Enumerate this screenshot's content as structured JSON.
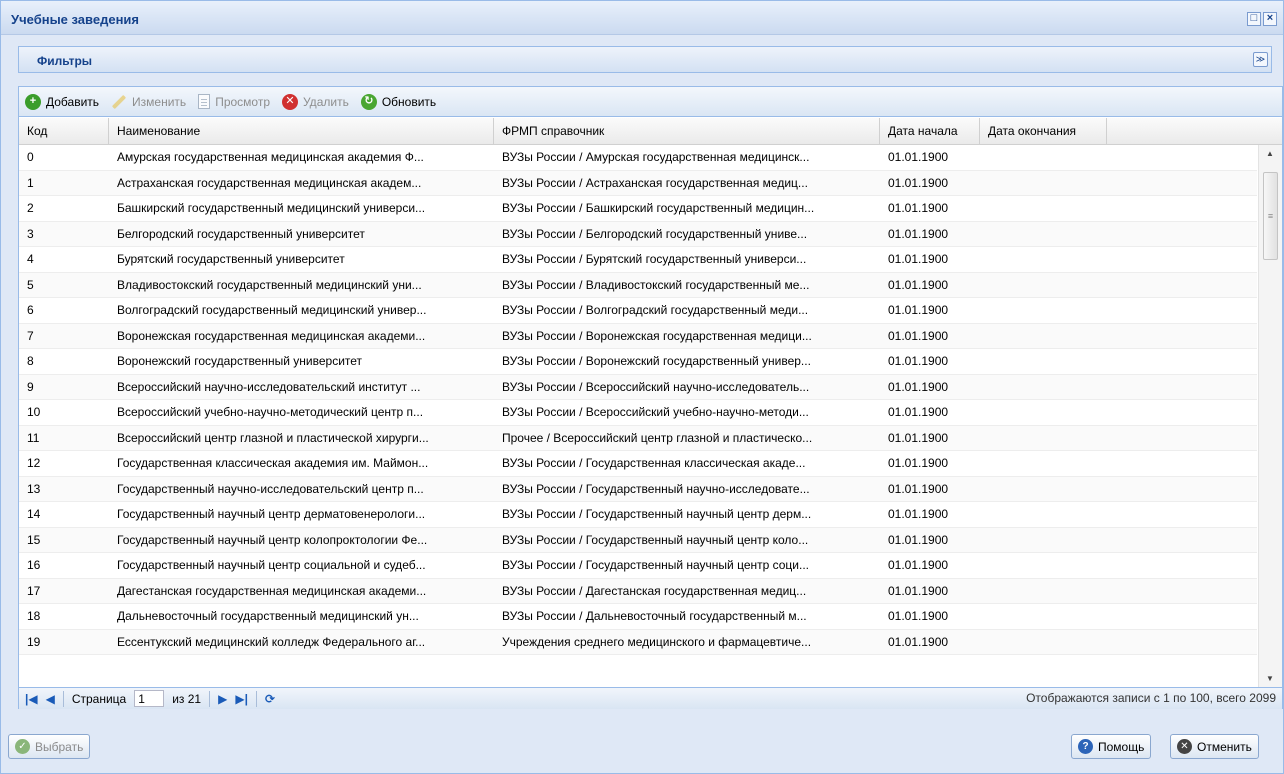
{
  "window": {
    "title": "Учебные заведения",
    "tool_maximize": "□",
    "tool_close": "×"
  },
  "filters": {
    "title": "Фильтры",
    "toggle": "≫"
  },
  "toolbar": {
    "add": "Добавить",
    "edit": "Изменить",
    "view": "Просмотр",
    "delete": "Удалить",
    "refresh": "Обновить"
  },
  "grid": {
    "columns": [
      "Код",
      "Наименование",
      "ФРМП справочник",
      "Дата начала",
      "Дата окончания"
    ],
    "rows": [
      [
        "0",
        "Амурская государственная медицинская академия Ф...",
        "ВУЗы России / Амурская государственная медицинск...",
        "01.01.1900",
        ""
      ],
      [
        "1",
        "Астраханская государственная медицинская академ...",
        "ВУЗы России / Астраханская государственная медиц...",
        "01.01.1900",
        ""
      ],
      [
        "2",
        "Башкирский государственный медицинский универси...",
        "ВУЗы России / Башкирский государственный медицин...",
        "01.01.1900",
        ""
      ],
      [
        "3",
        "Белгородский государственный университет",
        "ВУЗы России / Белгородский государственный униве...",
        "01.01.1900",
        ""
      ],
      [
        "4",
        "Бурятский государственный университет",
        "ВУЗы России / Бурятский государственный универси...",
        "01.01.1900",
        ""
      ],
      [
        "5",
        "Владивостокский государственный медицинский уни...",
        "ВУЗы России / Владивостокский государственный ме...",
        "01.01.1900",
        ""
      ],
      [
        "6",
        "Волгоградский государственный медицинский универ...",
        "ВУЗы России / Волгоградский государственный меди...",
        "01.01.1900",
        ""
      ],
      [
        "7",
        "Воронежская государственная медицинская академи...",
        "ВУЗы России / Воронежская государственная медици...",
        "01.01.1900",
        ""
      ],
      [
        "8",
        "Воронежский государственный университет",
        "ВУЗы России / Воронежский государственный универ...",
        "01.01.1900",
        ""
      ],
      [
        "9",
        "Всероссийский научно-исследовательский институт ...",
        "ВУЗы России / Всероссийский научно-исследователь...",
        "01.01.1900",
        ""
      ],
      [
        "10",
        "Всероссийский учебно-научно-методический центр п...",
        "ВУЗы России / Всероссийский учебно-научно-методи...",
        "01.01.1900",
        ""
      ],
      [
        "11",
        "Всероссийский центр глазной и пластической хирурги...",
        "Прочее / Всероссийский центр глазной и пластическо...",
        "01.01.1900",
        ""
      ],
      [
        "12",
        "Государственная классическая академия им. Маймон...",
        "ВУЗы России / Государственная классическая акаде...",
        "01.01.1900",
        ""
      ],
      [
        "13",
        "Государственный научно-исследовательский центр п...",
        "ВУЗы России / Государственный научно-исследовате...",
        "01.01.1900",
        ""
      ],
      [
        "14",
        "Государственный научный центр дерматовенерологи...",
        "ВУЗы России / Государственный научный центр дерм...",
        "01.01.1900",
        ""
      ],
      [
        "15",
        "Государственный научный центр колопроктологии Фе...",
        "ВУЗы России / Государственный научный центр коло...",
        "01.01.1900",
        ""
      ],
      [
        "16",
        "Государственный научный центр социальной и судеб...",
        "ВУЗы России / Государственный научный центр соци...",
        "01.01.1900",
        ""
      ],
      [
        "17",
        "Дагестанская государственная медицинская академи...",
        "ВУЗы России / Дагестанская государственная медиц...",
        "01.01.1900",
        ""
      ],
      [
        "18",
        "Дальневосточный государственный медицинский ун...",
        "ВУЗы России / Дальневосточный государственный м...",
        "01.01.1900",
        ""
      ],
      [
        "19",
        "Ессентукский медицинский колледж Федерального аг...",
        "Учреждения среднего медицинского и фармацевтиче...",
        "01.01.1900",
        ""
      ]
    ]
  },
  "pager": {
    "page_label": "Страница",
    "page_value": "1",
    "of_label": "из 21",
    "info": "Отображаются записи с 1 по 100, всего 2099"
  },
  "footer": {
    "select": "Выбрать",
    "help": "Помощь",
    "cancel": "Отменить"
  }
}
